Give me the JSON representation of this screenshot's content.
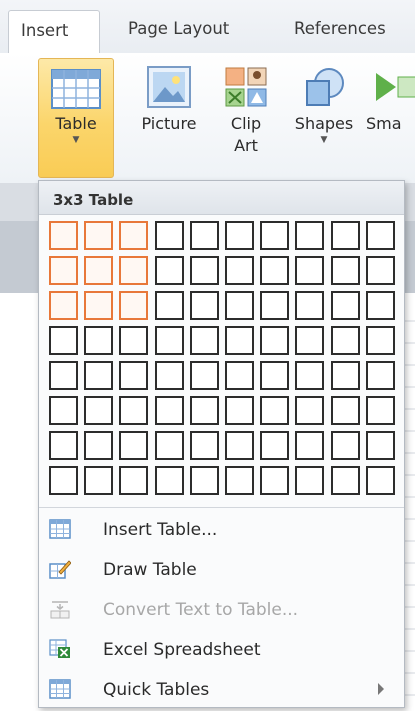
{
  "tabs": [
    {
      "label": "Insert",
      "active": true
    },
    {
      "label": "Page Layout",
      "active": false
    },
    {
      "label": "References",
      "active": false
    }
  ],
  "ribbon": {
    "table_label": "Table",
    "picture_label": "Picture",
    "clipart_label_1": "Clip",
    "clipart_label_2": "Art",
    "shapes_label": "Shapes",
    "smartart_label": "Sma"
  },
  "dropdown": {
    "header": "3x3 Table",
    "grid": {
      "columns": 10,
      "rows": 8,
      "selected_columns": 3,
      "selected_rows": 3
    },
    "menu": [
      {
        "label": "Insert Table...",
        "icon": "insert-table-icon",
        "enabled": true
      },
      {
        "label": "Draw Table",
        "icon": "draw-table-icon",
        "enabled": true
      },
      {
        "label": "Convert Text to Table...",
        "icon": "convert-text-icon",
        "enabled": false
      },
      {
        "label": "Excel Spreadsheet",
        "icon": "excel-spreadsheet-icon",
        "enabled": true
      },
      {
        "label": "Quick Tables",
        "icon": "quick-tables-icon",
        "enabled": true,
        "submenu": true
      }
    ]
  },
  "colors": {
    "selection": "#e8783a",
    "highlight": "#fbd56b"
  }
}
